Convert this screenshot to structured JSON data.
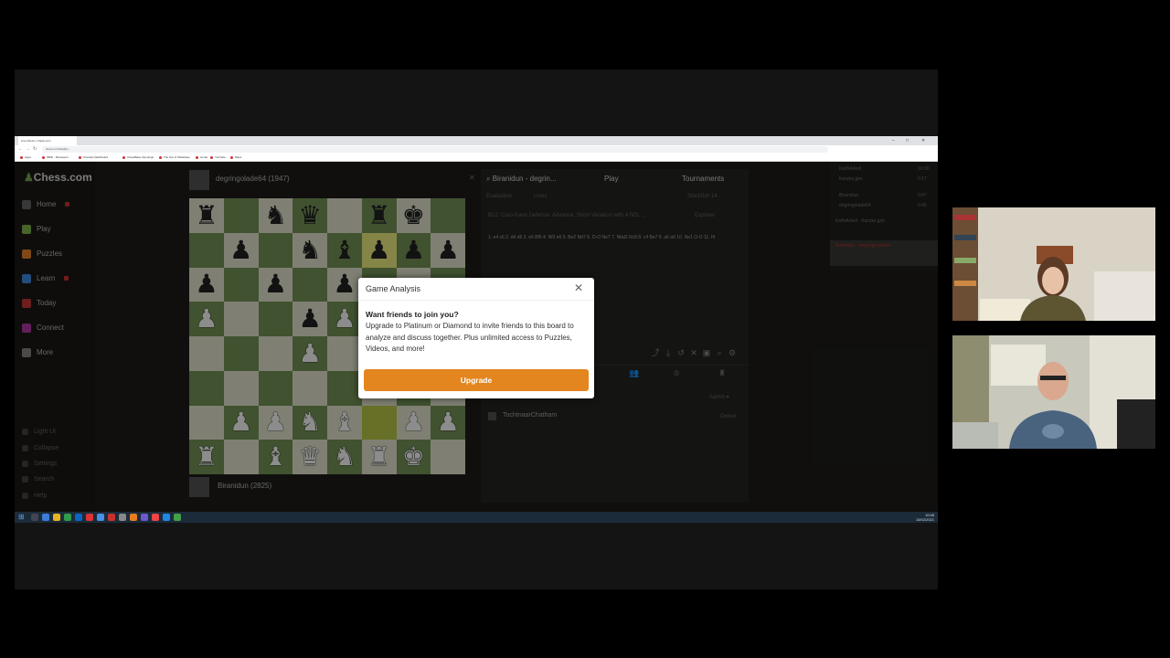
{
  "browser": {
    "tab_title": "Live Chess • Chess.com",
    "url": "chess.com/live#g=...",
    "bookmarks": [
      "Apps",
      "IMDb - Reviewers",
      "Chessify Dashboard",
      "ChessBase Openings",
      "The Sun & Tablebase",
      "Gmail",
      "YouTube",
      "Maps"
    ]
  },
  "sidebar": {
    "logo": "Chess.com",
    "items": [
      {
        "label": "Home",
        "color": "#c2c2c2"
      },
      {
        "label": "Play",
        "color": "#81b64c"
      },
      {
        "label": "Puzzles",
        "color": "#e9832b"
      },
      {
        "label": "Learn",
        "color": "#3f8ee6"
      },
      {
        "label": "Today",
        "color": "#c33a3a"
      },
      {
        "label": "Connect",
        "color": "#b33aa8"
      },
      {
        "label": "More",
        "color": "#888888"
      }
    ],
    "bottom_items": [
      "Light UI",
      "Collapse",
      "Settings",
      "Search",
      "Help"
    ]
  },
  "game": {
    "top_player": "degringolade64 (1947)",
    "bottom_player": "Biranidun (2825)"
  },
  "analysis": {
    "header": "Biranidun - degrin...",
    "play_tab": "Play",
    "tournaments_tab": "Tournaments",
    "toggle1": "Evaluation",
    "toggle2": "Lines",
    "engine": "Stockfish 14",
    "opening": "B12: Caro-Kann Defense: Advance, Short Variation with 4.Nf3, ...",
    "explorer": "Explorer",
    "moves": "1. e4 c6 2. d4 d5 3. e5 Bf5 4. Nf3 e6 5. Be2 Nd7 6. O-O Ne7 7. Nbd2 Nc8 8. c4 Be7 9. a5 a6 10. Ne1 O-O 11. f4",
    "admin": "Admin",
    "member_name": "TochtnaarChatham",
    "member_role": "Owner"
  },
  "right_column": {
    "lines": [
      "KeithArkell",
      "franzkz.jpm",
      "Biranidun",
      "degringolade64",
      "KeithArkell - franzkz.jpm"
    ],
    "times": [
      "10:00",
      "0:17",
      "0:47",
      "0:45"
    ],
    "selected": "Biranidun - degringolade64"
  },
  "modal": {
    "title": "Game Analysis",
    "close_icon": "close-icon",
    "heading": "Want friends to join you?",
    "body": "Upgrade to Platinum or Diamond to invite friends to this board to analyze and discuss together. Plus unlimited access to Puzzles, Videos, and more!",
    "button": "Upgrade",
    "button_color": "#e3861f"
  },
  "taskbar": {
    "time": "10:08",
    "date": "15/02/2021"
  }
}
